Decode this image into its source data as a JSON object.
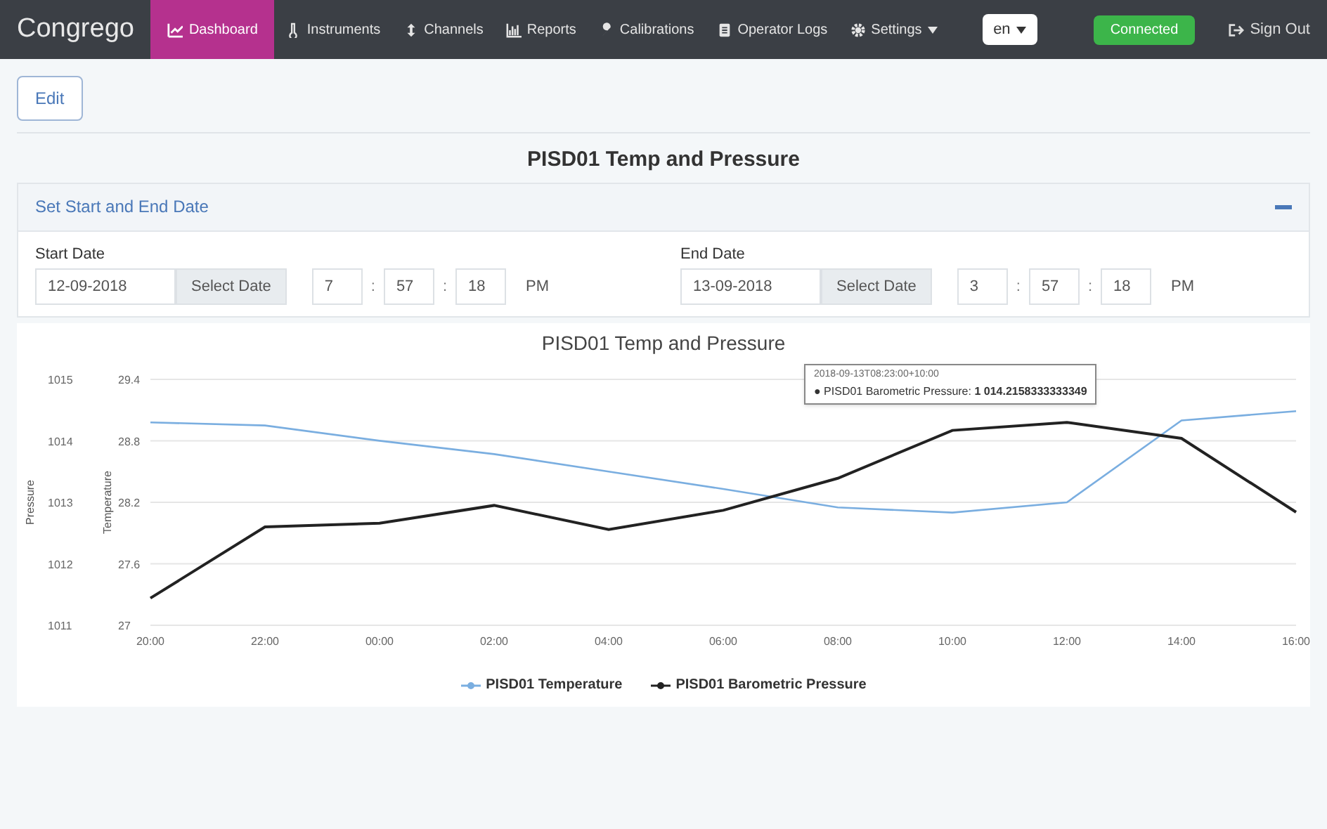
{
  "navbar": {
    "brand": "Congrego",
    "items": [
      {
        "label": "Dashboard",
        "selected": true,
        "dropdown": false
      },
      {
        "label": "Instruments",
        "selected": false,
        "dropdown": false
      },
      {
        "label": "Channels",
        "selected": false,
        "dropdown": false
      },
      {
        "label": "Reports",
        "selected": false,
        "dropdown": false
      },
      {
        "label": "Calibrations",
        "selected": false,
        "dropdown": false
      },
      {
        "label": "Operator Logs",
        "selected": false,
        "dropdown": false
      },
      {
        "label": "Settings",
        "selected": false,
        "dropdown": true
      }
    ],
    "language": "en",
    "status": "Connected",
    "sign_out": "Sign Out"
  },
  "edit_button": "Edit",
  "page_title": "PISD01 Temp and Pressure",
  "date_panel": {
    "title": "Set Start and End Date",
    "expanded": true,
    "start": {
      "label": "Start Date",
      "date": "12-09-2018",
      "button": "Select Date",
      "hour": "7",
      "separator_1": ":",
      "minute": "57",
      "separator_2": ":",
      "second": "18",
      "ampm": "PM"
    },
    "end": {
      "label": "End Date",
      "date": "13-09-2018",
      "button": "Select Date",
      "hour": "3",
      "separator_1": ":",
      "minute": "57",
      "separator_2": ":",
      "second": "18",
      "ampm": "PM"
    }
  },
  "chart": {
    "tooltip": {
      "time": "2018-09-13T08:23:00+10:00",
      "text": "● PISD01 Barometric Pressure: **1 014.2158333333349**"
    },
    "chart_data": {
      "type": "line",
      "title": "PISD01 Temp and Pressure",
      "ylabel": "Pressure",
      "y2label": "Temperature",
      "categories": [
        "20:00",
        "22:00",
        "00:00",
        "02:00",
        "04:00",
        "06:00",
        "08:00",
        "10:00",
        "12:00",
        "14:00",
        "16:00"
      ],
      "ylim": [
        1011,
        1015
      ],
      "y2lim": [
        27,
        29.4
      ],
      "grid": true,
      "yticks": [
        1011,
        1012,
        1013,
        1014,
        1015
      ],
      "y2ticks": [
        27,
        27.6,
        28.2,
        28.8,
        29.4
      ],
      "series": [
        {
          "name": "PISD01 Temperature",
          "color": "#7aaee0",
          "axis": "y2",
          "values": [
            28.98,
            28.95,
            28.8,
            28.67,
            28.5,
            28.33,
            28.15,
            28.1,
            28.2,
            29.0,
            29.09
          ]
        },
        {
          "name": "PISD01 Barometric Pressure",
          "color": "#222222",
          "axis": "y",
          "values": [
            1011.44,
            1012.6,
            1012.66,
            1012.95,
            1012.56,
            1012.87,
            1013.39,
            1014.17,
            1014.3,
            1014.04,
            1012.84
          ]
        }
      ]
    }
  }
}
